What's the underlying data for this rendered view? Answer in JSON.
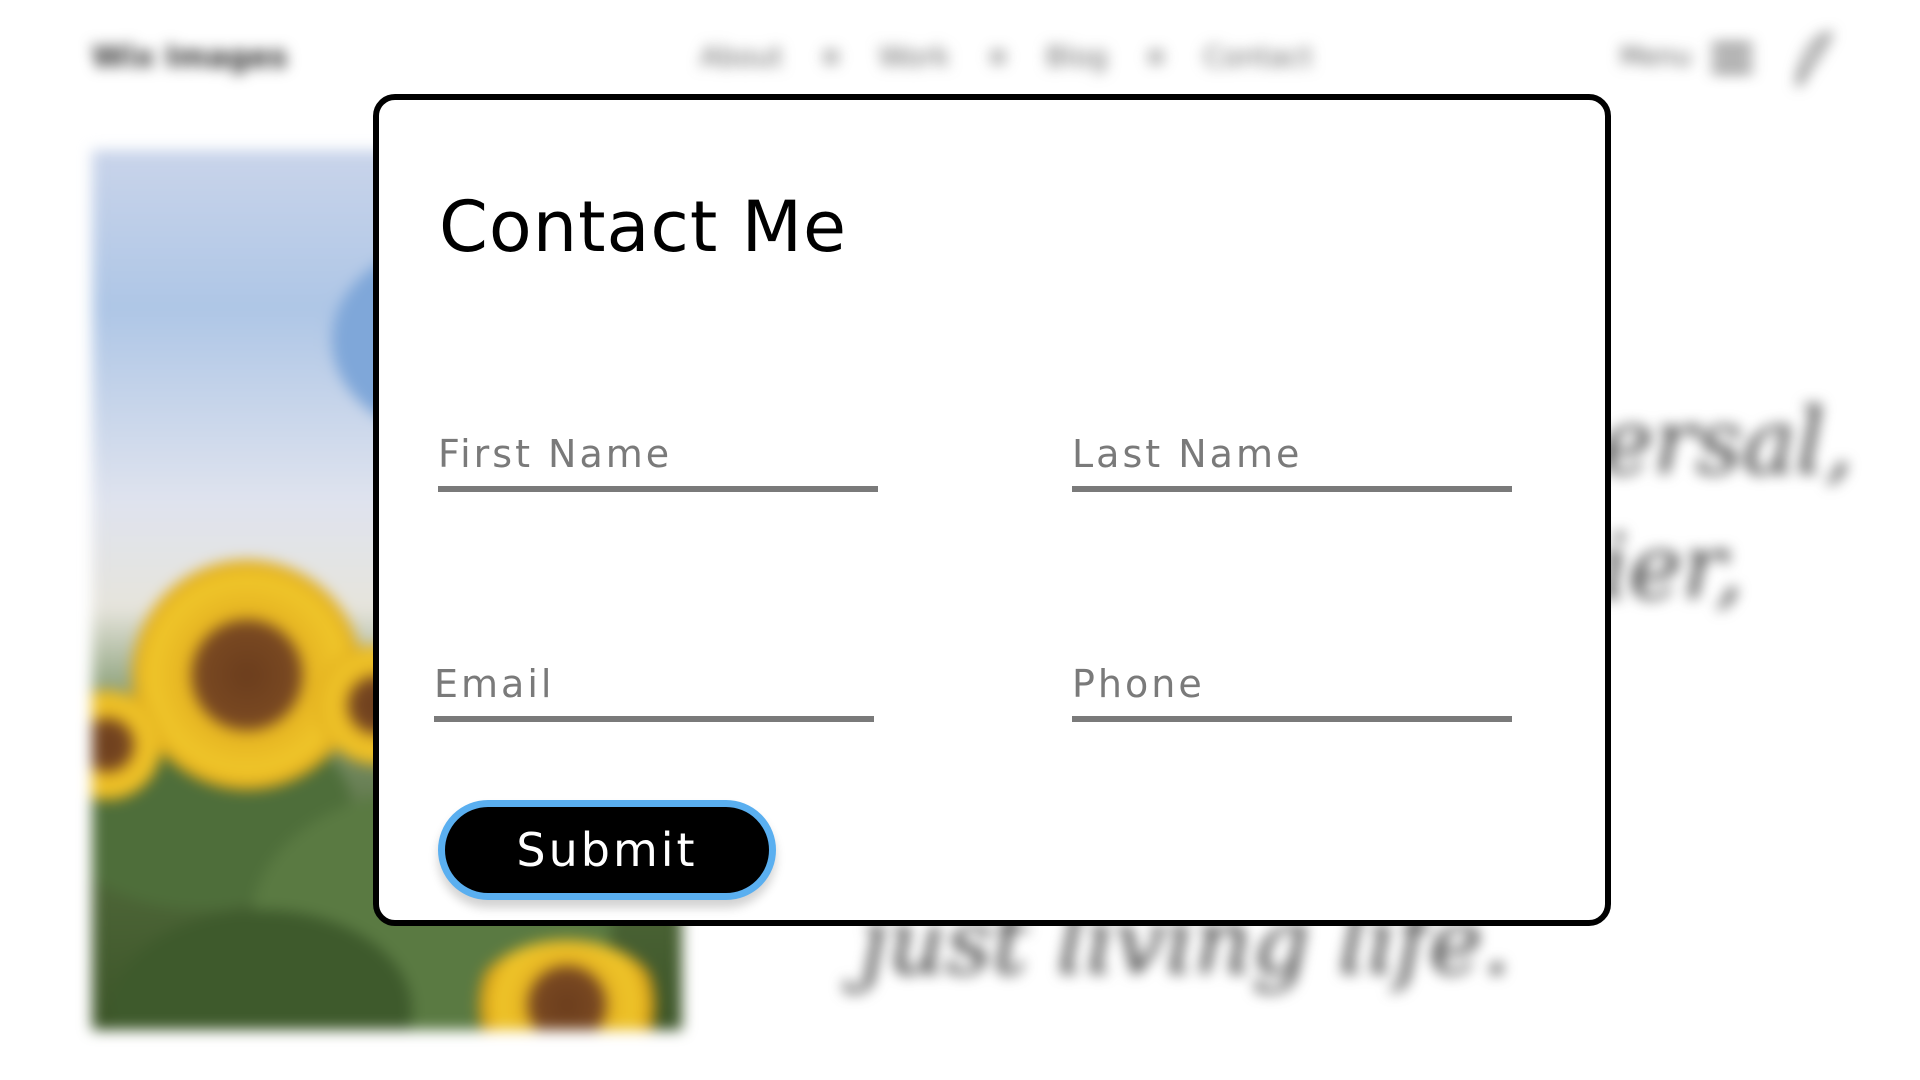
{
  "background": {
    "logo": "Wix Images",
    "nav": [
      "About",
      "Work",
      "Blog",
      "Contact"
    ],
    "menu_label": "Menu",
    "headline_lines": [
      "ersal,",
      "ier,",
      "just living life."
    ]
  },
  "modal": {
    "title": "Contact Me",
    "fields": {
      "first_name": {
        "placeholder": "First Name",
        "value": ""
      },
      "last_name": {
        "placeholder": "Last Name",
        "value": ""
      },
      "email": {
        "placeholder": "Email",
        "value": ""
      },
      "phone": {
        "placeholder": "Phone",
        "value": ""
      }
    },
    "submit_label": "Submit"
  },
  "colors": {
    "modal_border": "#000000",
    "field_underline": "#7a7a7a",
    "button_bg": "#000000",
    "button_focus_ring": "#5aaff0"
  },
  "icons": [
    "hamburger-menu-icon",
    "feather-icon"
  ]
}
